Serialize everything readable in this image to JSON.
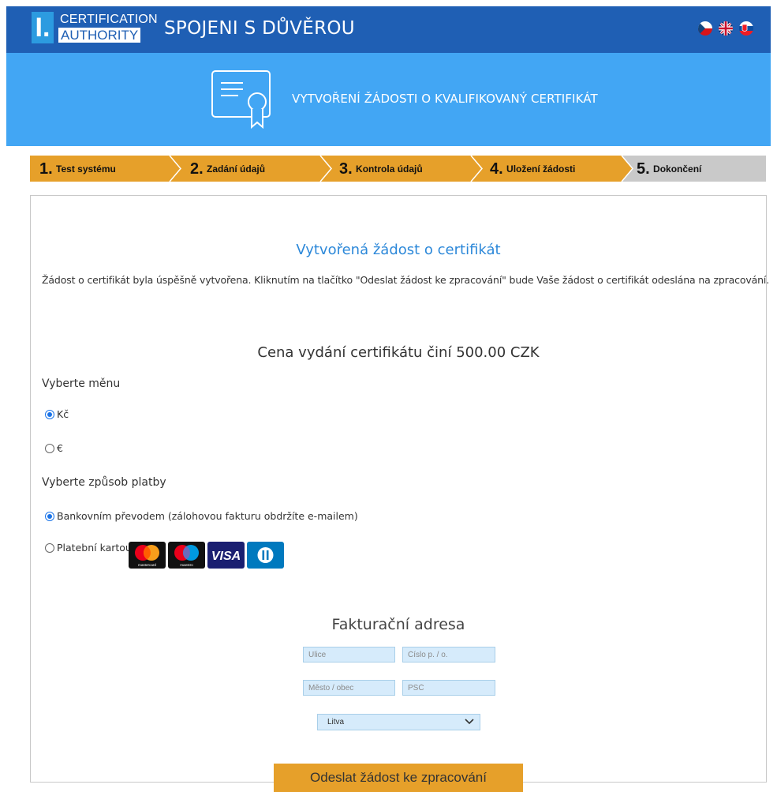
{
  "header": {
    "logo_letter": "I.",
    "logo_line1": "CERTIFICATION",
    "logo_line2": "AUTHORITY",
    "title": "SPOJENI S DŮVĚROU",
    "languages": [
      "czech-flag",
      "uk-flag",
      "slovak-flag"
    ]
  },
  "banner": {
    "icon": "certificate-icon",
    "title": "VYTVOŘENÍ ŽÁDOSTI O KVALIFIKOVANÝ CERTIFIKÁT"
  },
  "steps": [
    {
      "num": "1.",
      "label": "Test systému"
    },
    {
      "num": "2.",
      "label": "Zadání údajů"
    },
    {
      "num": "3.",
      "label": "Kontrola údajů"
    },
    {
      "num": "4.",
      "label": "Uložení žádosti"
    },
    {
      "num": "5.",
      "label": "Dokončení"
    }
  ],
  "colors": {
    "header_bg": "#1f5fb4",
    "banner_bg": "#42a6f4",
    "step_done": "#e6a02a",
    "step_current": "#c9c9c9",
    "accent_blue": "#2c88d9",
    "button": "#e6a02a"
  },
  "main": {
    "heading": "Vytvořená žádost o certifikát",
    "intro": "Žádost o certifikát byla úspěšně vytvořena. Kliknutím na tlačítko \"Odeslat žádost ke zpracování\" bude Vaše žádost o certifikát odeslána na zpracování.",
    "price": "Cena vydání certifikátu činí 500.00 CZK",
    "currency_label": "Vyberte měnu",
    "currency_options": [
      {
        "label": "Kč",
        "selected": true
      },
      {
        "label": "€",
        "selected": false
      }
    ],
    "payment_label": "Vyberte způsob platby",
    "payment_options": [
      {
        "label": "Bankovním převodem (zálohovou fakturu obdržíte e-mailem)",
        "selected": true
      },
      {
        "label": "Platební kartou",
        "selected": false
      }
    ],
    "cards": [
      {
        "icon": "mastercard-icon",
        "caption": "mastercard"
      },
      {
        "icon": "maestro-icon",
        "caption": "maestro"
      },
      {
        "icon": "visa-icon",
        "caption": "VISA"
      },
      {
        "icon": "diners-club-icon",
        "caption": ""
      }
    ]
  },
  "billing": {
    "heading": "Fakturační adresa",
    "street_placeholder": "Ulice",
    "number_placeholder": "Číslo p. / o.",
    "city_placeholder": "Město / obec",
    "zip_placeholder": "PSČ",
    "country_value": "Litva"
  },
  "submit_label": "Odeslat žádost ke zpracování"
}
